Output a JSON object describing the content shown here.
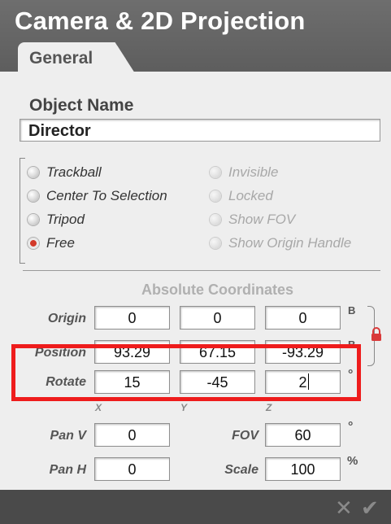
{
  "window": {
    "title": "Camera & 2D Projection"
  },
  "tabs": [
    {
      "label": "General",
      "selected": true
    }
  ],
  "object_name": {
    "label": "Object Name",
    "value": "Director"
  },
  "radio_options": {
    "left": [
      {
        "label": "Trackball",
        "checked": false,
        "enabled": true
      },
      {
        "label": "Center To Selection",
        "checked": false,
        "enabled": true
      },
      {
        "label": "Tripod",
        "checked": false,
        "enabled": true
      },
      {
        "label": "Free",
        "checked": true,
        "enabled": true
      }
    ],
    "right": [
      {
        "label": "Invisible",
        "checked": false,
        "enabled": false
      },
      {
        "label": "Locked",
        "checked": false,
        "enabled": false
      },
      {
        "label": "Show FOV",
        "checked": false,
        "enabled": false
      },
      {
        "label": "Show Origin Handle",
        "checked": false,
        "enabled": false
      }
    ]
  },
  "coordinates": {
    "heading": "Absolute Coordinates",
    "origin": {
      "label": "Origin",
      "x": "0",
      "y": "0",
      "z": "0",
      "unit": "B"
    },
    "position": {
      "label": "Position",
      "x": "93.29",
      "y": "67.15",
      "z": "-93.29",
      "unit": "B"
    },
    "rotate": {
      "label": "Rotate",
      "x": "15",
      "y": "-45",
      "z": "2",
      "unit": "°"
    },
    "axis_labels": {
      "x": "X",
      "y": "Y",
      "z": "Z"
    },
    "pan_v": {
      "label": "Pan V",
      "value": "0"
    },
    "pan_h": {
      "label": "Pan H",
      "value": "0"
    },
    "fov": {
      "label": "FOV",
      "value": "60",
      "unit": "°"
    },
    "scale": {
      "label": "Scale",
      "value": "100",
      "unit": "%"
    }
  },
  "footer": {
    "cancel_icon": "close-icon",
    "ok_icon": "check-icon"
  },
  "colors": {
    "highlight": "#ee1c1c",
    "radio_checked": "#d23a2a",
    "lock": "#d93a3a",
    "titlebar": "#666666"
  }
}
